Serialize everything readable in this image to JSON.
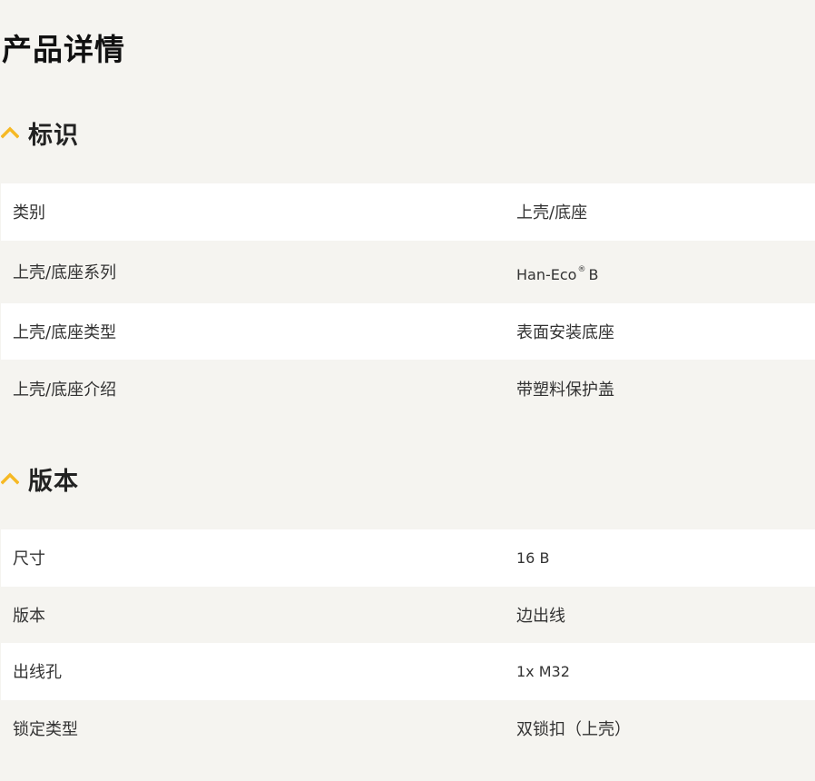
{
  "page": {
    "title": "产品详情"
  },
  "colors": {
    "accent": "#f6b924",
    "page_bg": "#f5f4f0",
    "row_white": "#ffffff",
    "text": "#333333"
  },
  "sections": [
    {
      "title": "标识",
      "icon": "chevron-up-icon",
      "expanded": true,
      "rows": [
        {
          "label": "类别",
          "value": "上壳/底座"
        },
        {
          "label": "上壳/底座系列",
          "value": "Han-Eco",
          "value_suffix_symbol": "®",
          "value_suffix": "B"
        },
        {
          "label": "上壳/底座类型",
          "value": "表面安装底座"
        },
        {
          "label": "上壳/底座介绍",
          "value": "带塑料保护盖"
        }
      ]
    },
    {
      "title": "版本",
      "icon": "chevron-up-icon",
      "expanded": true,
      "rows": [
        {
          "label": "尺寸",
          "value": "16 B"
        },
        {
          "label": "版本",
          "value": "边出线"
        },
        {
          "label": "出线孔",
          "value": "1x M32"
        },
        {
          "label": "锁定类型",
          "value": "双锁扣（上壳）"
        }
      ]
    }
  ]
}
